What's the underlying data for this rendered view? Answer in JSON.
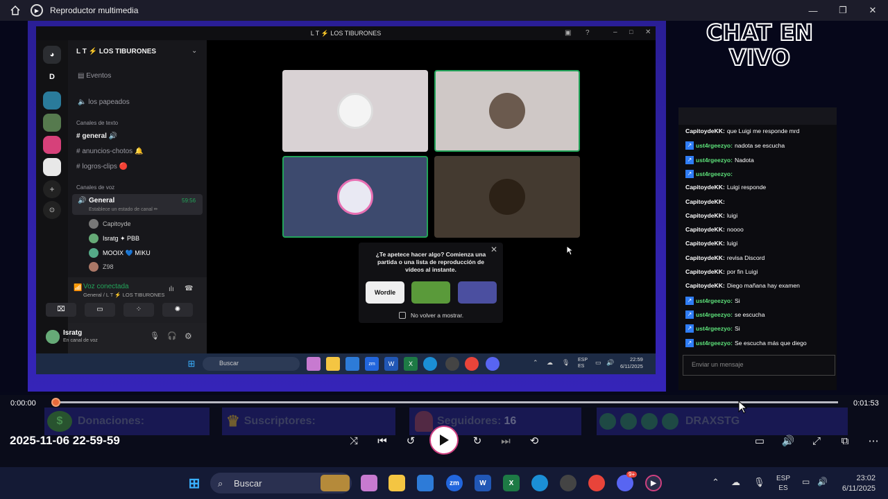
{
  "window": {
    "title": "Reproductor multimedia"
  },
  "discord": {
    "window_title": "L T ⚡ LOS TIBURONES",
    "server_name": "L T ⚡ LOS TIBURONES",
    "server_initial": "D",
    "events_label": "Eventos",
    "voice_top": "los papeados",
    "text_channels_header": "Canales de texto",
    "text_channels": [
      "general 🔊",
      "anuncios-chotos 🔔",
      "logros-clips 🔴"
    ],
    "voice_channels_header": "Canales de voz",
    "voice_channel_name": "General",
    "voice_channel_sub": "Establece un estado de canal ✏",
    "voice_channel_time": "59:56",
    "voice_users": [
      "Capitoyde",
      "Isratg ✦ PBB",
      "MOOIX 💙 MIKU",
      "Z98"
    ],
    "connected_title": "Voz conectada",
    "connected_sub": "General / L T ⚡ LOS TIBURONES",
    "user_name": "Isratg",
    "user_status": "En canal de voz",
    "popup_text": "¿Te apetece hacer algo? Comienza una partida o una lista de reproducción de vídeos al instante.",
    "popup_checkbox": "No volver a mostrar.",
    "activity_wordle": "Wordle"
  },
  "inner_taskbar": {
    "search": "Buscar",
    "lang1": "ESP",
    "lang2": "ES",
    "time": "22:59",
    "date": "6/11/2025"
  },
  "chat": {
    "title": "CHAT EN VIVO",
    "messages": [
      {
        "user": "CapitoydeKK:",
        "text": "que Luigi me responde mrd",
        "badge": false
      },
      {
        "user": "ust4rgeezyo:",
        "text": "nadota se escucha",
        "badge": true
      },
      {
        "user": "ust4rgeezyo:",
        "text": "Nadota",
        "badge": true
      },
      {
        "user": "ust4rgeezyo:",
        "text": "",
        "badge": true
      },
      {
        "user": "CapitoydeKK:",
        "text": "Luigi responde",
        "badge": false
      },
      {
        "user": "CapitoydeKK:",
        "text": "",
        "badge": false
      },
      {
        "user": "CapitoydeKK:",
        "text": "luigi",
        "badge": false
      },
      {
        "user": "CapitoydeKK:",
        "text": "noooo",
        "badge": false
      },
      {
        "user": "CapitoydeKK:",
        "text": "luigi",
        "badge": false
      },
      {
        "user": "CapitoydeKK:",
        "text": "revisa Discord",
        "badge": false
      },
      {
        "user": "CapitoydeKK:",
        "text": "por fin Luigi",
        "badge": false
      },
      {
        "user": "CapitoydeKK:",
        "text": "Diego mañana hay examen",
        "badge": false
      },
      {
        "user": "ust4rgeezyo:",
        "text": "Si",
        "badge": true
      },
      {
        "user": "ust4rgeezyo:",
        "text": "se escucha",
        "badge": true
      },
      {
        "user": "ust4rgeezyo:",
        "text": "Si",
        "badge": true
      },
      {
        "user": "ust4rgeezyo:",
        "text": "Se escucha más que diego",
        "badge": true
      }
    ],
    "input_placeholder": "Enviar un mensaje"
  },
  "overlay": {
    "donations": "Donaciones:",
    "subscribers": "Suscriptores:",
    "followers": "Seguidores:",
    "followers_count": "16",
    "name": "DRAXSTG"
  },
  "player": {
    "current_time": "0:00:00",
    "total_time": "0:01:53",
    "datestamp": "2025-11-06 22-59-59",
    "progress": 0.0
  },
  "taskbar": {
    "search": "Buscar",
    "lang1": "ESP",
    "lang2": "ES",
    "time": "23:02",
    "date": "6/11/2025",
    "discord_badge": "9+"
  },
  "colors": {
    "accent": "#e86a3b",
    "chat_user": "#5de27a",
    "discord_green": "#23a55a",
    "chat_bg": "#0c0c10"
  }
}
